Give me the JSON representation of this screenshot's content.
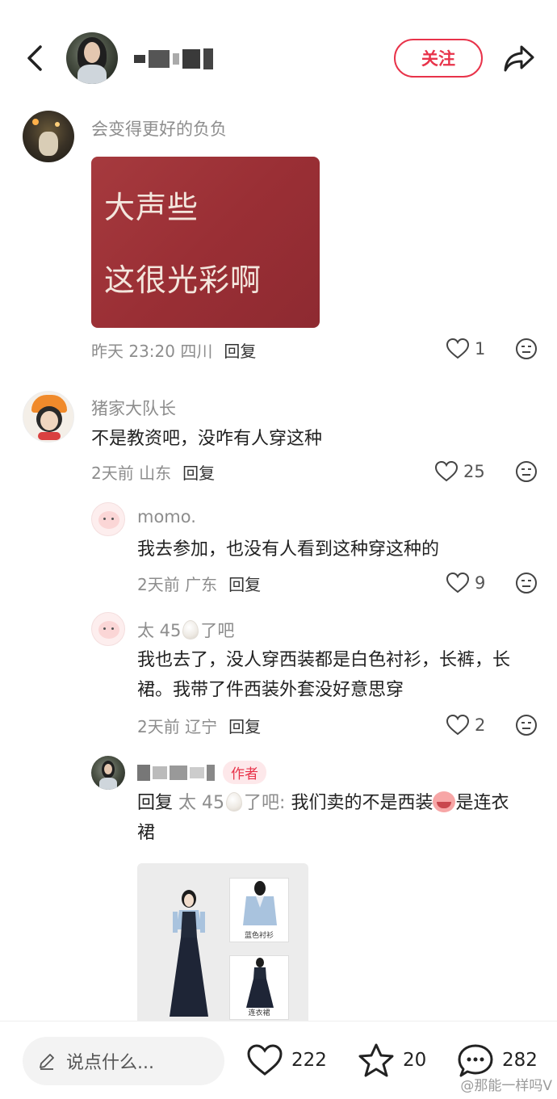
{
  "header": {
    "follow_label": "关注"
  },
  "comments": [
    {
      "name": "会变得更好的负负",
      "meme_line1": "大声些",
      "meme_line2": "这很光彩啊",
      "time": "昨天 23:20 四川",
      "reply_label": "回复",
      "likes": "1"
    },
    {
      "name": "猪家大队长",
      "text": "不是教资吧，没咋有人穿这种",
      "time": "2天前 山东",
      "reply_label": "回复",
      "likes": "25",
      "replies": [
        {
          "name": "momo.",
          "text": "我去参加，也没有人看到这种穿这种的",
          "time": "2天前 广东",
          "reply_label": "回复",
          "likes": "9"
        },
        {
          "name_prefix": "太 45",
          "name_suffix": "了吧",
          "text": "我也去了，没人穿西装都是白色衬衫，长裤，长裙。我带了件西装外套没好意思穿",
          "time": "2天前 辽宁",
          "reply_label": "回复",
          "likes": "2"
        },
        {
          "author_badge": "作者",
          "reply_prefix": "回复",
          "reply_target_prefix": "太 45",
          "reply_target_suffix": "了吧:",
          "text_a": "我们卖的不是西装",
          "text_b": "是连衣裙",
          "product_labels": [
            "蓝色衬衫",
            "连衣裙"
          ]
        }
      ]
    }
  ],
  "bottom_bar": {
    "input_placeholder": "说点什么...",
    "likes": "222",
    "favorites": "20",
    "comments": "282",
    "watermark": "@那能一样吗V"
  },
  "colors": {
    "accent": "#e8334a",
    "meta_gray": "#8d8d8d",
    "meme_red": "#9a2f35"
  }
}
